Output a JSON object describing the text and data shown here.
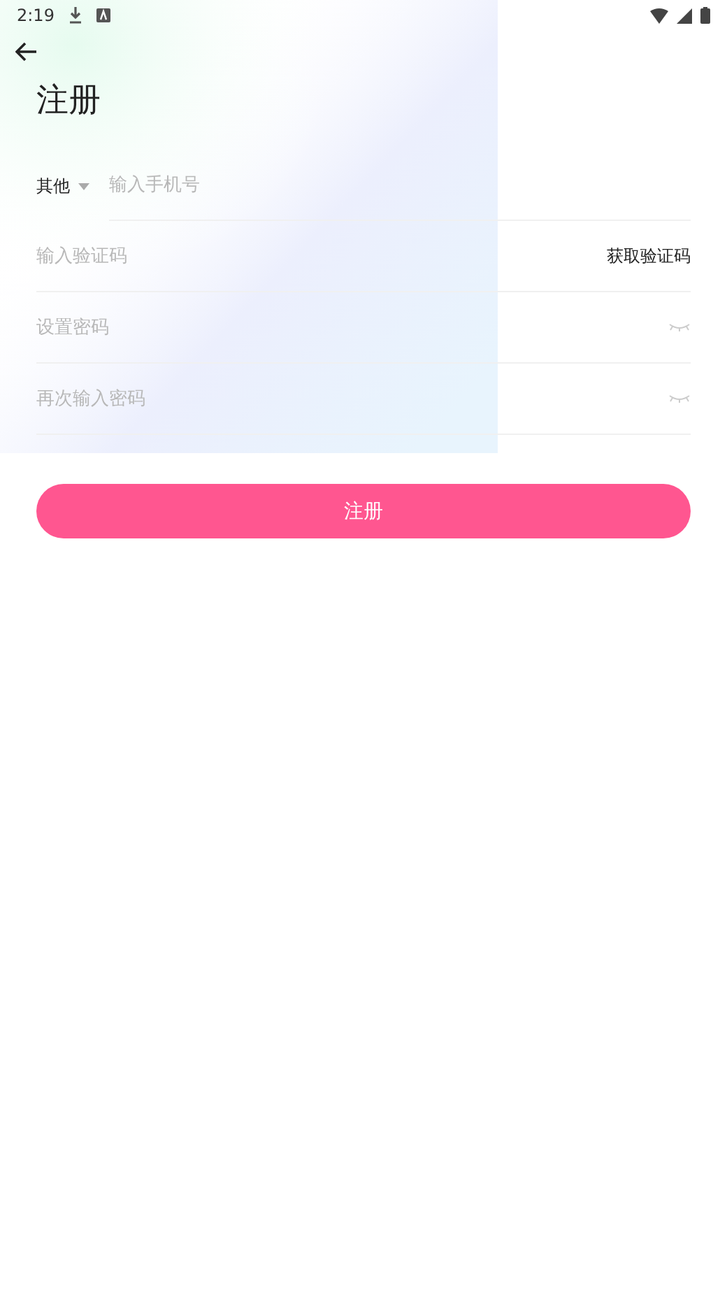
{
  "status_bar": {
    "time": "2:19"
  },
  "title": "注册",
  "fields": [
    {
      "kind": "phone",
      "region": "其他",
      "placeholder": "输入手机号"
    },
    {
      "kind": "code",
      "placeholder": "输入验证码",
      "action": "获取验证码"
    },
    {
      "kind": "password",
      "placeholder": "设置密码"
    },
    {
      "kind": "password",
      "placeholder": "再次输入密码"
    }
  ],
  "submit": "注册"
}
